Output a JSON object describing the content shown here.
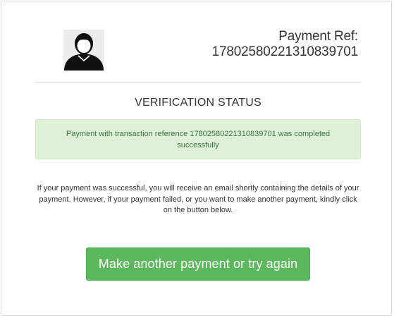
{
  "header": {
    "payment_ref_label": "Payment Ref:",
    "payment_ref_number": "17802580221310839701",
    "avatar_icon": "user-silhouette-icon"
  },
  "status": {
    "title": "VERIFICATION STATUS",
    "alert_message": "Payment with transaction reference 17802580221310839701 was completed successfully"
  },
  "info": {
    "text": "If your payment was successful, you will receive an email shortly containing the details of your payment. However, if your payment failed, or you want to make another payment, kindly click on the button below."
  },
  "actions": {
    "retry_label": "Make another payment or try again"
  },
  "colors": {
    "success_bg": "#dff0d8",
    "success_text": "#3c763d",
    "button_bg": "#5cb85c"
  }
}
